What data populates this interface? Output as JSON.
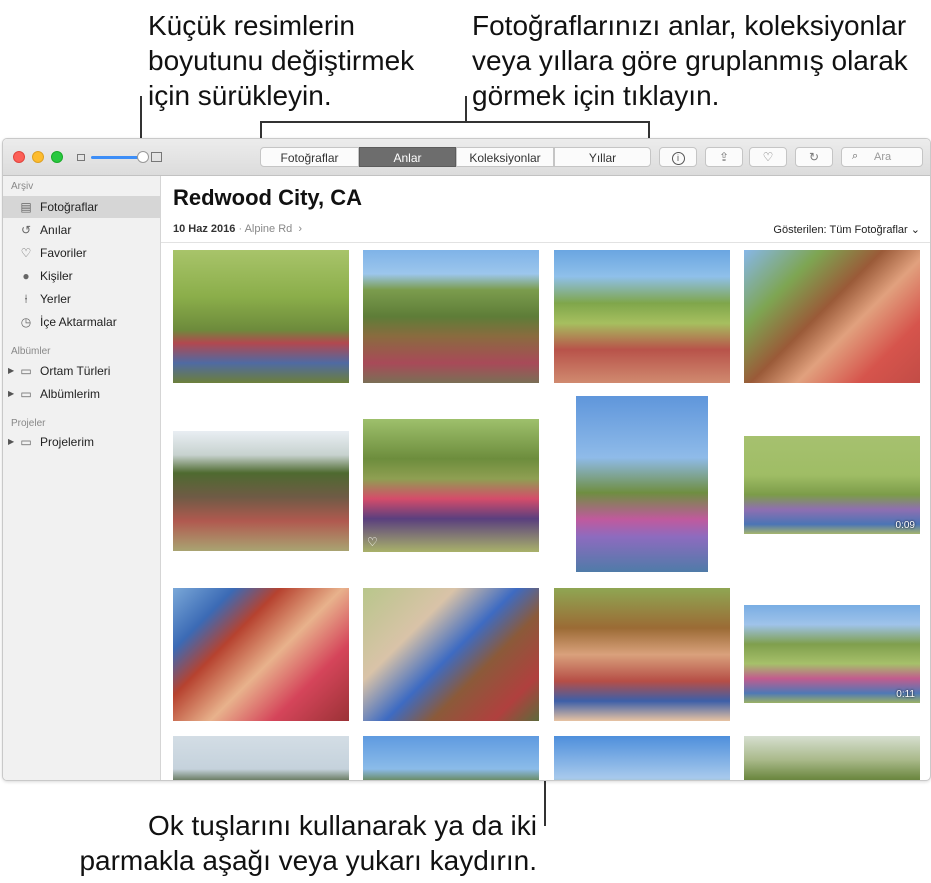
{
  "callouts": {
    "thumbnail_size": "Küçük resimlerin\nboyutunu değiştirmek\niçin sürükleyin.",
    "view_tabs": "Fotoğraflarınızı anlar, koleksiyonlar\nveya yıllara göre gruplanmış olarak\ngörmek için tıklayın.",
    "scroll": "Ok tuşlarını kullanarak ya da iki\nparmakla aşağı veya yukarı kaydırın."
  },
  "toolbar": {
    "tabs": [
      "Fotoğraflar",
      "Anlar",
      "Koleksiyonlar",
      "Yıllar"
    ],
    "active_tab": "Anlar",
    "info_icon": "info-icon",
    "share_icon": "share-icon",
    "favorite_icon": "heart-icon",
    "rotate_icon": "rotate-icon",
    "search_placeholder": "Ara",
    "slider_value": 1.0
  },
  "sidebar": {
    "library_header": "Arşiv",
    "library_items": [
      {
        "label": "Fotoğraflar",
        "icon": "photos-icon",
        "selected": true
      },
      {
        "label": "Anılar",
        "icon": "memories-icon"
      },
      {
        "label": "Favoriler",
        "icon": "heart-icon"
      },
      {
        "label": "Kişiler",
        "icon": "person-icon"
      },
      {
        "label": "Yerler",
        "icon": "pin-icon"
      },
      {
        "label": "İçe Aktarmalar",
        "icon": "clock-icon"
      }
    ],
    "albums_header": "Albümler",
    "album_items": [
      {
        "label": "Ortam Türleri",
        "icon": "folder-icon"
      },
      {
        "label": "Albümlerim",
        "icon": "folder-icon"
      }
    ],
    "projects_header": "Projeler",
    "project_items": [
      {
        "label": "Projelerim",
        "icon": "folder-icon"
      }
    ]
  },
  "main": {
    "title": "Redwood City, CA",
    "date": "10 Haz 2016",
    "location": "Alpine Rd",
    "chevron": "›",
    "showing": "Gösterilen: Tüm Fotoğraflar",
    "photos": [
      {
        "theme": "family-hill"
      },
      {
        "theme": "boy-hill"
      },
      {
        "theme": "mother-son"
      },
      {
        "theme": "mother-son-close"
      },
      {
        "theme": "back-view"
      },
      {
        "theme": "family-picnic",
        "favorite": "♡"
      },
      {
        "theme": "family-sky"
      },
      {
        "theme": "family-field",
        "duration": "0:09"
      },
      {
        "theme": "kids-close"
      },
      {
        "theme": "father-son"
      },
      {
        "theme": "boy-eating"
      },
      {
        "theme": "family-meadow",
        "duration": "0:11"
      },
      {
        "theme": "sky-trees"
      },
      {
        "theme": "sky-hills"
      },
      {
        "theme": "sky-field"
      },
      {
        "theme": "grass"
      }
    ]
  }
}
